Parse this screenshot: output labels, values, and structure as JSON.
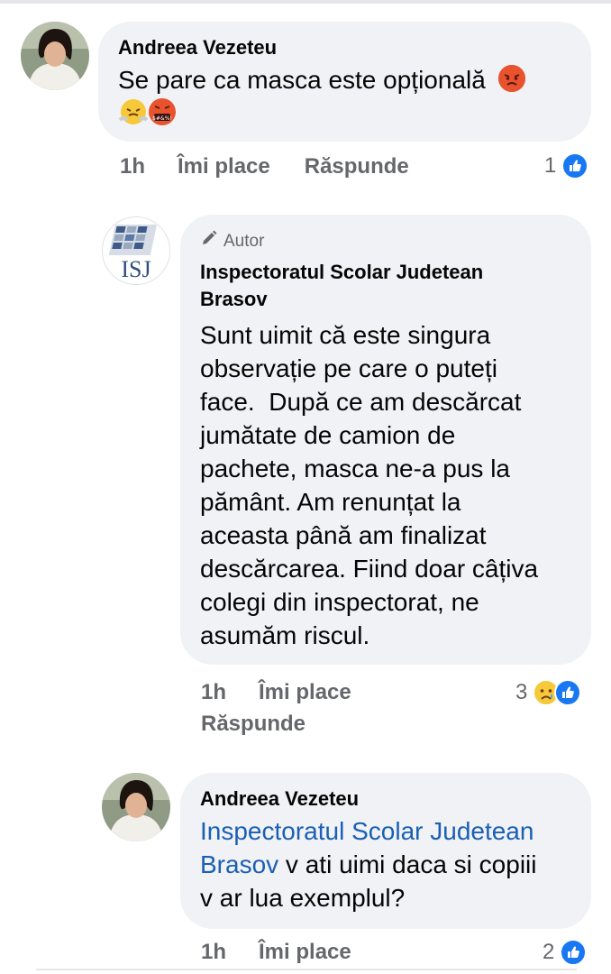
{
  "comments": [
    {
      "author": "Andreea Vezeteu",
      "text": "Se pare ca masca este opțională",
      "time": "1h",
      "like_label": "Îmi place",
      "reply_label": "Răspunde",
      "reaction_count": "1",
      "emojis": [
        "angry-face-icon",
        "face-with-steam-icon",
        "cursing-face-icon"
      ]
    },
    {
      "author_badge": "Autor",
      "author_line1": "Inspectoratul Scolar Judetean",
      "author_line2": "Brasov",
      "text_lines": [
        "Sunt uimit că este singura",
        "observație pe care o puteți",
        "face.  După ce am descărcat",
        "jumătate de camion de",
        "pachete, masca ne-a pus la",
        "pământ. Am renunțat la",
        "aceasta până am finalizat",
        "descărcarea. Fiind doar câțiva",
        "colegi din inspectorat, ne",
        "asumăm riscul."
      ],
      "avatar_label": "ISJ",
      "time": "1h",
      "like_label": "Îmi place",
      "reply_label": "Răspunde",
      "reaction_count": "3"
    },
    {
      "author": "Andreea Vezeteu",
      "mention_line1": "Inspectoratul Scolar Judetean",
      "mention_line2": "Brasov",
      "text_line2_rest": " v ati uimi daca si copiii",
      "text_line3": "v ar lua exemplul?",
      "time": "1h",
      "like_label": "Îmi place",
      "reaction_count": "2"
    }
  ],
  "colors": {
    "bubble": "#f0f2f5",
    "meta_gray": "#65676b",
    "mention_blue": "#1a5fb4",
    "like_blue": "#1877f2"
  }
}
